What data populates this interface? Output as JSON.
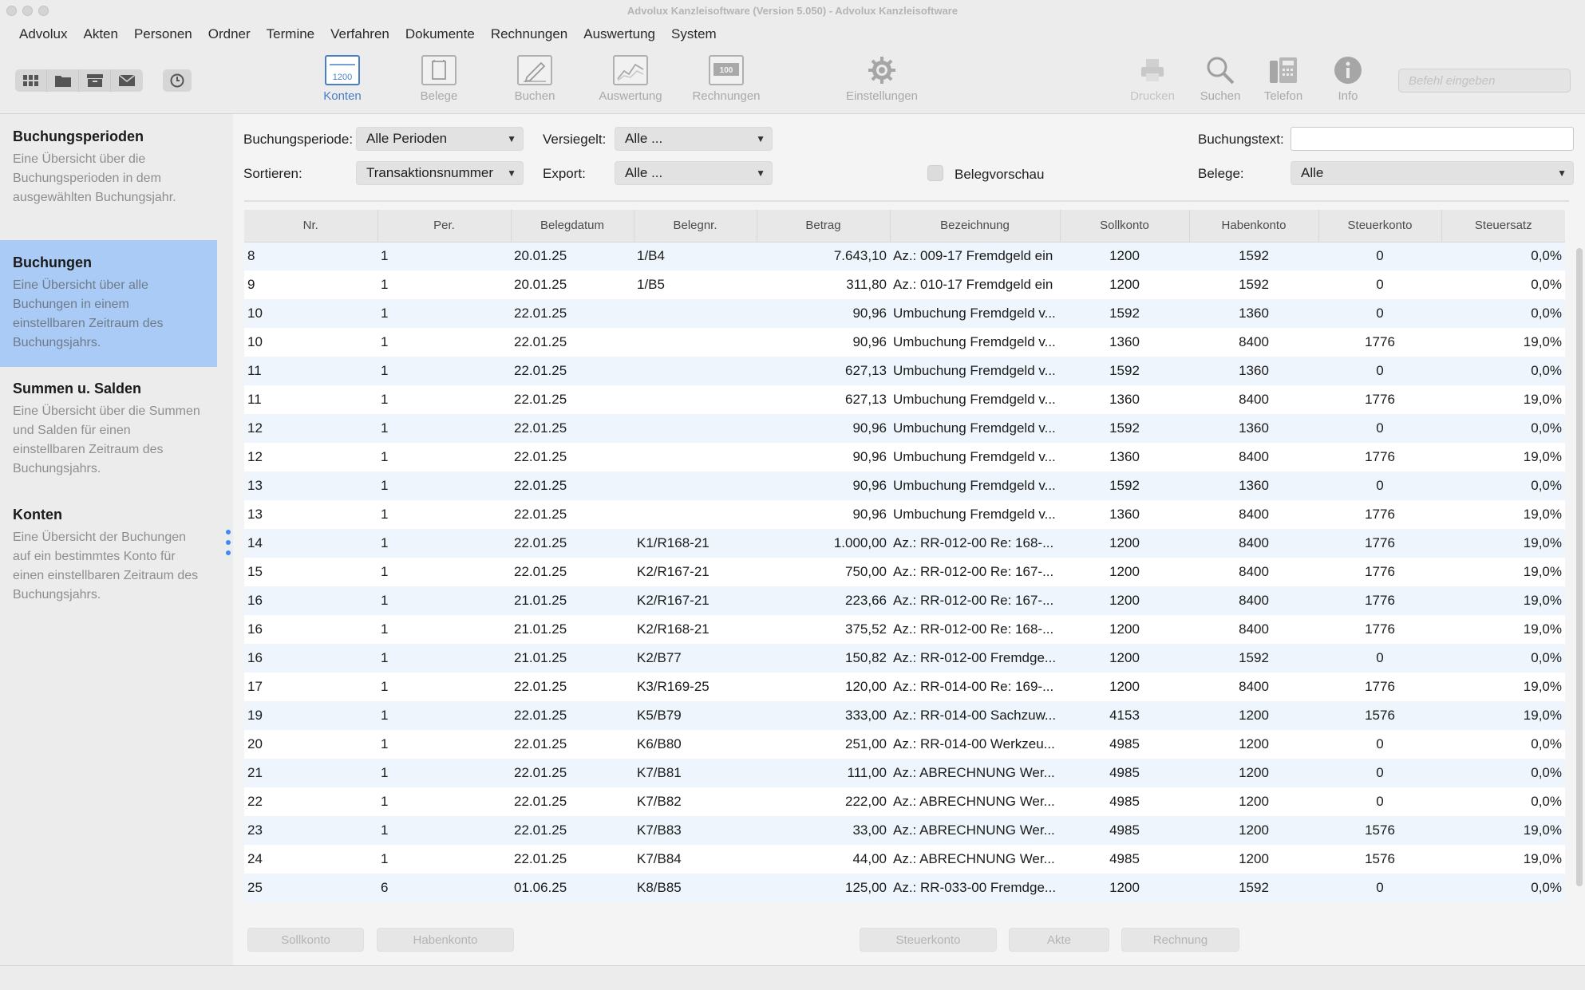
{
  "window": {
    "title": "Advolux Kanzleisoftware (Version 5.050) - Advolux Kanzleisoftware"
  },
  "menu": [
    "Advolux",
    "Akten",
    "Personen",
    "Ordner",
    "Termine",
    "Verfahren",
    "Dokumente",
    "Rechnungen",
    "Auswertung",
    "System"
  ],
  "toolbar": {
    "left_icons": [
      "grid-icon",
      "folder-icon",
      "archive-icon",
      "mail-icon"
    ],
    "clock_icon": "clock-icon",
    "tools": [
      {
        "label": "Konten",
        "icon": "ledger-icon",
        "icon_text": "1200",
        "active": true
      },
      {
        "label": "Belege",
        "icon": "receipt-icon",
        "active": false
      },
      {
        "label": "Buchen",
        "icon": "pencil-icon",
        "active": false
      },
      {
        "label": "Auswertung",
        "icon": "chart-icon",
        "active": false
      },
      {
        "label": "Rechnungen",
        "icon": "invoice-icon",
        "icon_text": "100",
        "active": false
      },
      {
        "label": "Einstellungen",
        "icon": "gear-icon",
        "active": false
      },
      {
        "label": "Drucken",
        "icon": "printer-icon",
        "active": false
      },
      {
        "label": "Suchen",
        "icon": "search-icon",
        "active": false
      },
      {
        "label": "Telefon",
        "icon": "phone-icon",
        "active": false
      },
      {
        "label": "Info",
        "icon": "info-icon",
        "active": false
      }
    ],
    "command_placeholder": "Befehl eingeben"
  },
  "sidebar": {
    "items": [
      {
        "title": "Buchungsperioden",
        "desc": "Eine Übersicht über die Buchungsperioden in dem ausgewählten Buchungsjahr.",
        "selected": false
      },
      {
        "title": "Buchungen",
        "desc": "Eine Übersicht über alle Buchungen in einem einstellbaren Zeitraum des Buchungsjahrs.",
        "selected": true
      },
      {
        "title": "Summen u. Salden",
        "desc": "Eine Übersicht über die Summen und Salden für einen einstellbaren Zeitraum des Buchungsjahrs.",
        "selected": false
      },
      {
        "title": "Konten",
        "desc": "Eine Übersicht der Buchungen auf ein bestimmtes Konto für einen einstellbaren Zeitraum des Buchungsjahrs.",
        "selected": false
      }
    ]
  },
  "filters": {
    "buchungsperiode_label": "Buchungsperiode:",
    "buchungsperiode_value": "Alle Perioden",
    "versiegelt_label": "Versiegelt:",
    "versiegelt_value": "Alle ...",
    "sortieren_label": "Sortieren:",
    "sortieren_value": "Transaktionsnummer",
    "export_label": "Export:",
    "export_value": "Alle ...",
    "belegvorschau_label": "Belegvorschau",
    "buchungstext_label": "Buchungstext:",
    "buchungstext_value": "",
    "belege_label": "Belege:",
    "belege_value": "Alle",
    "arrow": "▼"
  },
  "table": {
    "columns": [
      "Nr.",
      "Per.",
      "Belegdatum",
      "Belegnr.",
      "Betrag",
      "Bezeichnung",
      "Sollkonto",
      "Habenkonto",
      "Steuerkonto",
      "Steuersatz"
    ],
    "rows": [
      [
        "8",
        "1",
        "20.01.25",
        "1/B4",
        "7.643,10",
        "Az.: 009-17 Fremdgeld ein",
        "1200",
        "1592",
        "0",
        "0,0%"
      ],
      [
        "9",
        "1",
        "20.01.25",
        "1/B5",
        "311,80",
        "Az.: 010-17 Fremdgeld ein",
        "1200",
        "1592",
        "0",
        "0,0%"
      ],
      [
        "10",
        "1",
        "22.01.25",
        "",
        "90,96",
        "Umbuchung Fremdgeld v...",
        "1592",
        "1360",
        "0",
        "0,0%"
      ],
      [
        "10",
        "1",
        "22.01.25",
        "",
        "90,96",
        "Umbuchung Fremdgeld v...",
        "1360",
        "8400",
        "1776",
        "19,0%"
      ],
      [
        "11",
        "1",
        "22.01.25",
        "",
        "627,13",
        "Umbuchung Fremdgeld v...",
        "1592",
        "1360",
        "0",
        "0,0%"
      ],
      [
        "11",
        "1",
        "22.01.25",
        "",
        "627,13",
        "Umbuchung Fremdgeld v...",
        "1360",
        "8400",
        "1776",
        "19,0%"
      ],
      [
        "12",
        "1",
        "22.01.25",
        "",
        "90,96",
        "Umbuchung Fremdgeld v...",
        "1592",
        "1360",
        "0",
        "0,0%"
      ],
      [
        "12",
        "1",
        "22.01.25",
        "",
        "90,96",
        "Umbuchung Fremdgeld v...",
        "1360",
        "8400",
        "1776",
        "19,0%"
      ],
      [
        "13",
        "1",
        "22.01.25",
        "",
        "90,96",
        "Umbuchung Fremdgeld v...",
        "1592",
        "1360",
        "0",
        "0,0%"
      ],
      [
        "13",
        "1",
        "22.01.25",
        "",
        "90,96",
        "Umbuchung Fremdgeld v...",
        "1360",
        "8400",
        "1776",
        "19,0%"
      ],
      [
        "14",
        "1",
        "22.01.25",
        "K1/R168-21",
        "1.000,00",
        "Az.: RR-012-00 Re: 168-...",
        "1200",
        "8400",
        "1776",
        "19,0%"
      ],
      [
        "15",
        "1",
        "22.01.25",
        "K2/R167-21",
        "750,00",
        "Az.: RR-012-00 Re: 167-...",
        "1200",
        "8400",
        "1776",
        "19,0%"
      ],
      [
        "16",
        "1",
        "21.01.25",
        "K2/R167-21",
        "223,66",
        "Az.: RR-012-00 Re: 167-...",
        "1200",
        "8400",
        "1776",
        "19,0%"
      ],
      [
        "16",
        "1",
        "21.01.25",
        "K2/R168-21",
        "375,52",
        "Az.: RR-012-00 Re: 168-...",
        "1200",
        "8400",
        "1776",
        "19,0%"
      ],
      [
        "16",
        "1",
        "21.01.25",
        "K2/B77",
        "150,82",
        "Az.: RR-012-00 Fremdge...",
        "1200",
        "1592",
        "0",
        "0,0%"
      ],
      [
        "17",
        "1",
        "22.01.25",
        "K3/R169-25",
        "120,00",
        "Az.: RR-014-00 Re: 169-...",
        "1200",
        "8400",
        "1776",
        "19,0%"
      ],
      [
        "19",
        "1",
        "22.01.25",
        "K5/B79",
        "333,00",
        "Az.: RR-014-00 Sachzuw...",
        "4153",
        "1200",
        "1576",
        "19,0%"
      ],
      [
        "20",
        "1",
        "22.01.25",
        "K6/B80",
        "251,00",
        "Az.: RR-014-00 Werkzeu...",
        "4985",
        "1200",
        "0",
        "0,0%"
      ],
      [
        "21",
        "1",
        "22.01.25",
        "K7/B81",
        "111,00",
        "Az.: ABRECHNUNG Wer...",
        "4985",
        "1200",
        "0",
        "0,0%"
      ],
      [
        "22",
        "1",
        "22.01.25",
        "K7/B82",
        "222,00",
        "Az.: ABRECHNUNG Wer...",
        "4985",
        "1200",
        "0",
        "0,0%"
      ],
      [
        "23",
        "1",
        "22.01.25",
        "K7/B83",
        "33,00",
        "Az.: ABRECHNUNG Wer...",
        "4985",
        "1200",
        "1576",
        "19,0%"
      ],
      [
        "24",
        "1",
        "22.01.25",
        "K7/B84",
        "44,00",
        "Az.: ABRECHNUNG Wer...",
        "4985",
        "1200",
        "1576",
        "19,0%"
      ],
      [
        "25",
        "6",
        "01.06.25",
        "K8/B85",
        "125,00",
        "Az.: RR-033-00 Fremdge...",
        "1200",
        "1592",
        "0",
        "0,0%"
      ]
    ]
  },
  "buttons": {
    "sollkonto": "Sollkonto",
    "habenkonto": "Habenkonto",
    "steuerkonto": "Steuerkonto",
    "akte": "Akte",
    "rechnung": "Rechnung"
  }
}
